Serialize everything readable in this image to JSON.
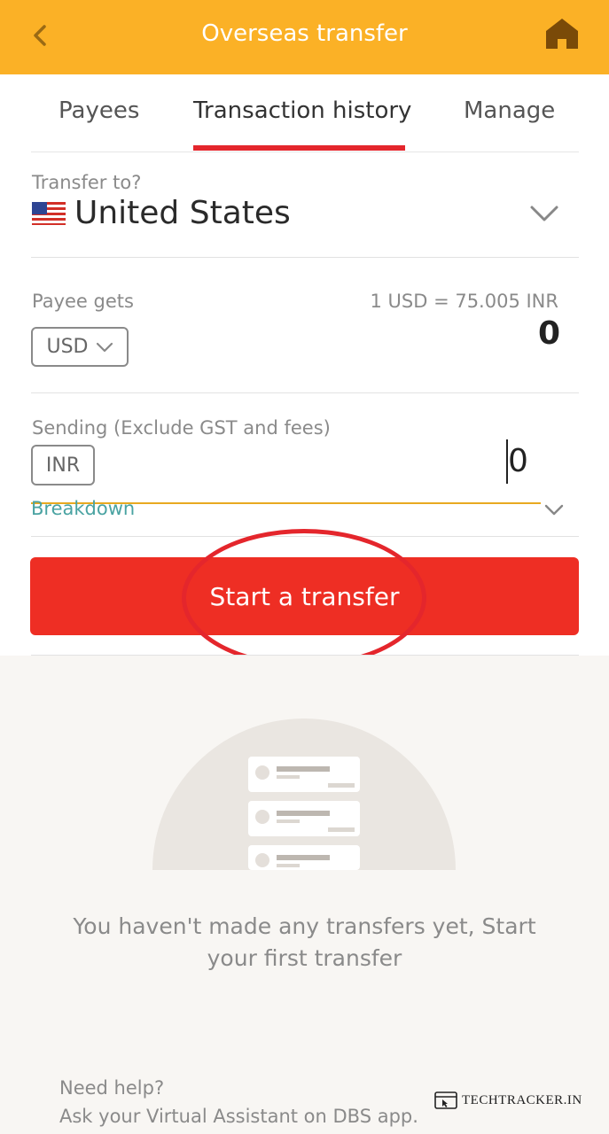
{
  "header": {
    "title": "Overseas transfer",
    "back_icon": "chevron-left-icon",
    "home_icon": "home-icon",
    "color": "#FBB126"
  },
  "tabs": [
    {
      "label": "Payees",
      "active": false
    },
    {
      "label": "Transaction history",
      "active": true
    },
    {
      "label": "Manage",
      "active": false
    }
  ],
  "transfer_to": {
    "label": "Transfer to?",
    "country": "United States",
    "flag_icon": "us-flag-icon"
  },
  "payee_gets": {
    "label": "Payee gets",
    "currency": "USD",
    "rate": "1 USD = 75.005 INR",
    "amount": "0"
  },
  "sending": {
    "label": "Sending (Exclude GST and fees)",
    "currency": "INR",
    "value": "0"
  },
  "breakdown_label": "Breakdown",
  "start_button": {
    "label": "Start a transfer",
    "color": "#EE2E24"
  },
  "empty_state": {
    "message": "You haven't made any transfers yet, Start your first transfer"
  },
  "help": {
    "title": "Need help?",
    "text": "Ask your Virtual Assistant on DBS app."
  },
  "watermark": "TECHTRACKER.IN"
}
